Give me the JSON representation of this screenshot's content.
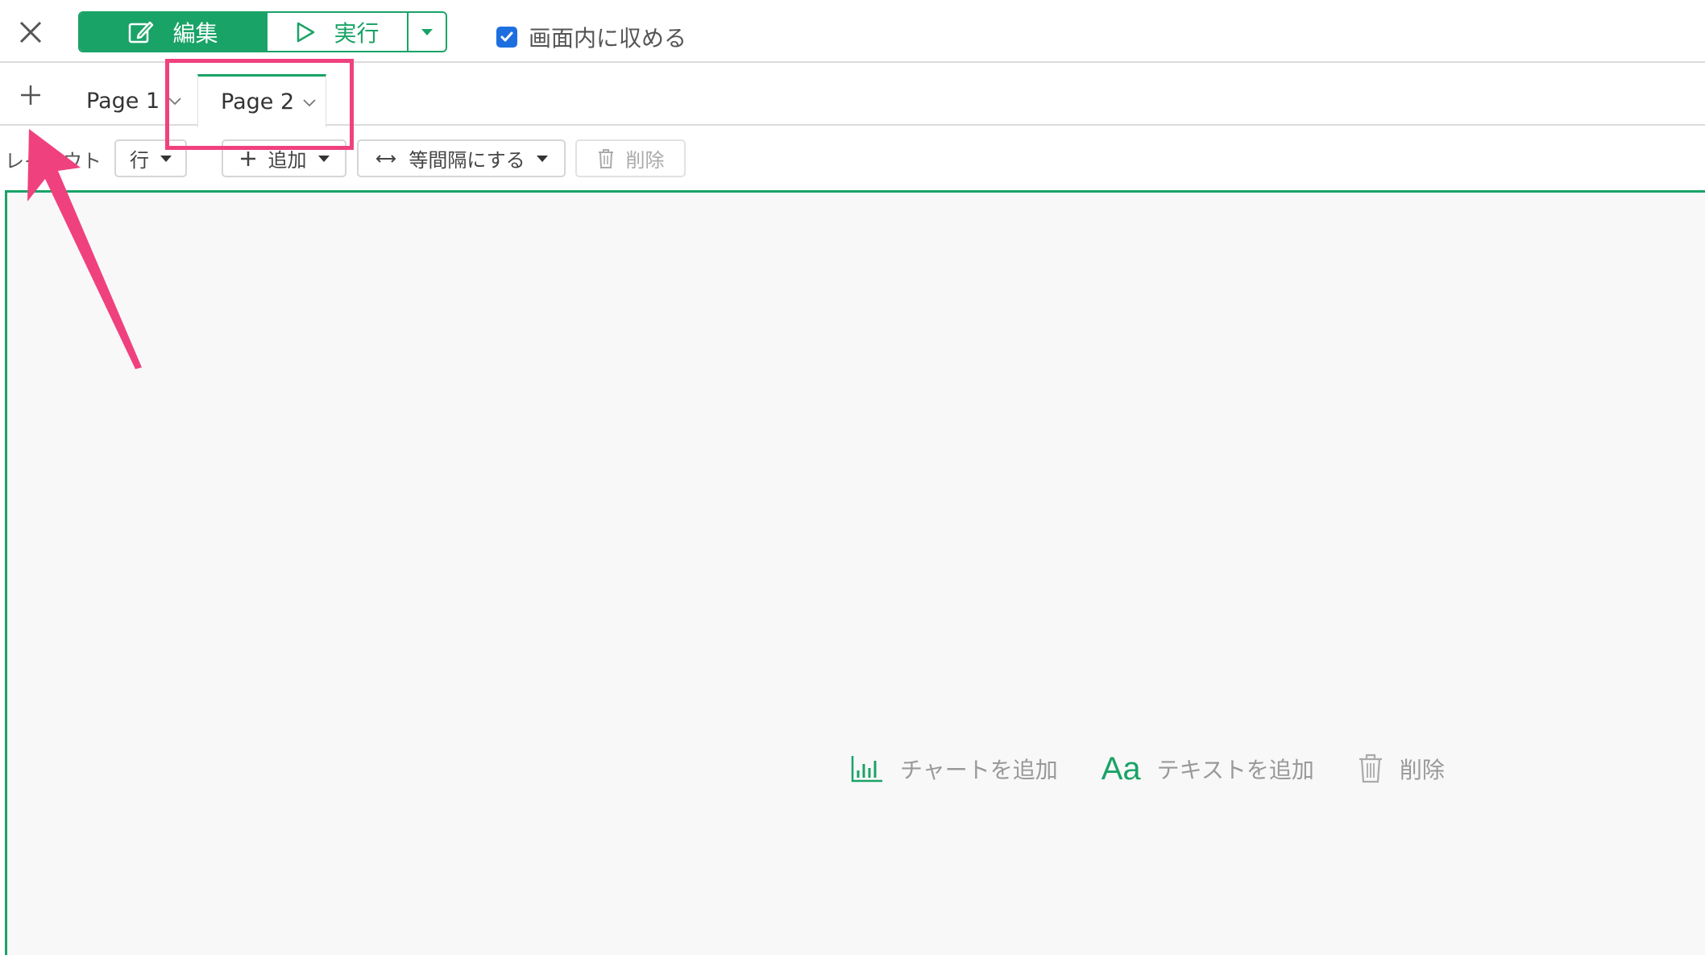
{
  "toolbar": {
    "edit_label": "編集",
    "run_label": "実行",
    "fit_label": "画面内に収める",
    "fit_checked": true
  },
  "tabs": [
    {
      "label": "Page 1"
    },
    {
      "label": "Page 2",
      "active": true
    }
  ],
  "layoutbar": {
    "layout_label": "レイアウト",
    "row_label": "行",
    "add_label": "追加",
    "equal_label": "等間隔にする",
    "delete_label": "削除"
  },
  "canvas": {
    "add_chart_label": "チャートを追加",
    "add_text_icon": "Aa",
    "add_text_label": "テキストを追加",
    "delete_label": "削除"
  },
  "colors": {
    "accent": "#1aa367",
    "annotation": "#f0417f",
    "checkbox": "#1d6fe0"
  }
}
